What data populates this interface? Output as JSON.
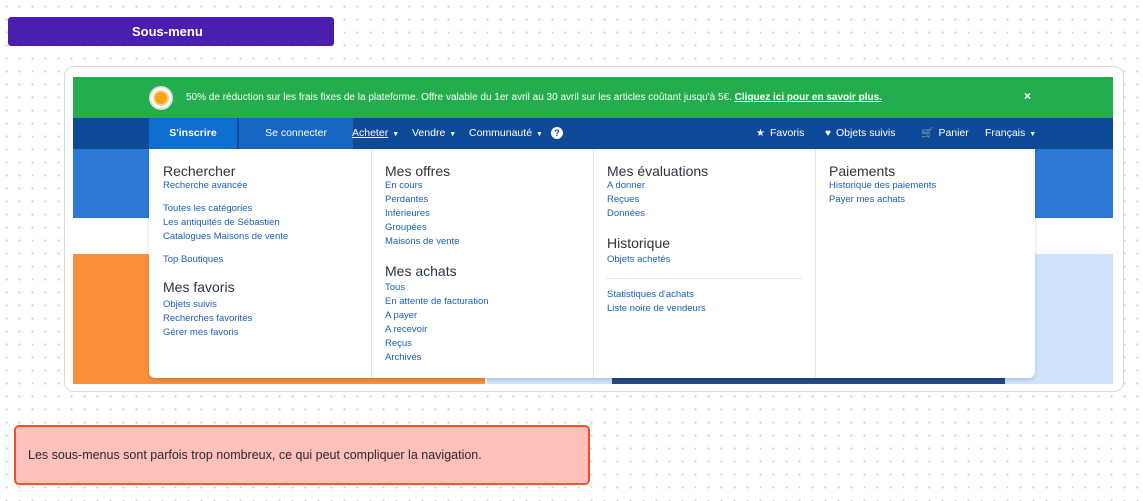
{
  "tag": {
    "label": "Sous-menu"
  },
  "banner": {
    "message": "50% de réduction sur les frais fixes de la plateforme. Offre valable du 1er avril au 30 avril sur les articles coûtant jusqu'à 5€. ",
    "link": "Cliquez ici pour en savoir plus.",
    "close": "×"
  },
  "nav": {
    "signup": "S'inscrire",
    "login": "Se connecter",
    "acheter": "Acheter",
    "vendre": "Vendre",
    "communaute": "Communauté",
    "favoris": "Favoris",
    "objets_suivis": "Objets suivis",
    "panier": "Panier",
    "langue": "Français"
  },
  "menu": {
    "col1": {
      "heading1": "Rechercher",
      "recherche_avancee": "Recherche avancée",
      "toutes_categories": "Toutes les catégories",
      "antiquites": "Les antiquités de Sébastien",
      "catalogues": "Catalogues Maisons de vente",
      "top_boutiques": "Top Boutiques",
      "heading2": "Mes favoris",
      "objets_suivis": "Objets suivis",
      "recherches_favorites": "Recherches favorites",
      "gerer_favoris": "Gérer mes favoris"
    },
    "col2": {
      "heading1": "Mes offres",
      "en_cours": "En cours",
      "perdantes": "Perdantes",
      "inferieures": "Inférieures",
      "groupees": "Groupées",
      "maisons_vente": "Maisons de vente",
      "heading2": "Mes achats",
      "tous": "Tous",
      "attente_facturation": "En attente de facturation",
      "a_payer": "A payer",
      "a_recevoir": "A recevoir",
      "recus": "Reçus",
      "archives": "Archivés"
    },
    "col3": {
      "heading1": "Mes évaluations",
      "a_donner": "A donner",
      "recues": "Reçues",
      "donnees": "Données",
      "heading2": "Historique",
      "objets_achetes": "Objets achetés",
      "statistiques": "Statistiques d'achats",
      "liste_noire": "Liste noire de vendeurs"
    },
    "col4": {
      "heading1": "Paiements",
      "historique_paiements": "Historique des paiements",
      "payer_achats": "Payer mes achats"
    }
  },
  "note": {
    "text": "Les sous-menus sont parfois trop nombreux, ce qui peut compliquer la navigation."
  }
}
